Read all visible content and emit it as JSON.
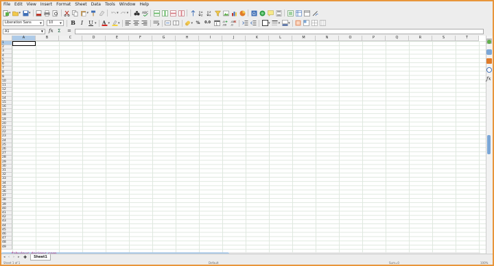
{
  "menu": [
    "File",
    "Edit",
    "View",
    "Insert",
    "Format",
    "Sheet",
    "Data",
    "Tools",
    "Window",
    "Help"
  ],
  "font": {
    "name": "Liberation Sans",
    "size": "10"
  },
  "formula": {
    "cell_ref": "A1",
    "fx": "fx",
    "sum": "Σ",
    "equals": "="
  },
  "columns": [
    "A",
    "B",
    "C",
    "D",
    "E",
    "F",
    "G",
    "H",
    "I",
    "J",
    "K",
    "L",
    "M",
    "N",
    "O",
    "P",
    "Q",
    "R",
    "S",
    "T"
  ],
  "rows": [
    "1",
    "2",
    "3",
    "4",
    "5",
    "6",
    "7",
    "8",
    "9",
    "10",
    "11",
    "12",
    "13",
    "14",
    "15",
    "16",
    "17",
    "18",
    "19",
    "20",
    "21",
    "22",
    "23",
    "24",
    "25",
    "26",
    "27",
    "28",
    "29",
    "30",
    "31",
    "32",
    "33",
    "34",
    "35",
    "36",
    "37",
    "38",
    "39",
    "40",
    "41",
    "42",
    "43",
    "44",
    "45",
    "46",
    "47",
    "48",
    "49"
  ],
  "sheet_tab": "Sheet1",
  "watermark": "fabulous-designs.com",
  "status": {
    "sheet": "Sheet 1 of 1",
    "style": "Default",
    "sum": "Sum=0",
    "zoom": "100%"
  },
  "toolbar_formatting": {
    "bold": "B",
    "italic": "I",
    "underline": "U",
    "percent": "%",
    "decimal": "0.0"
  },
  "colors": {
    "accent": "#e8953a",
    "selection": "#aecbe8",
    "grid": "#dfe8df",
    "font_color": "#d7261f",
    "highlight": "#f4d23a",
    "border_color": "#2a4d8f"
  }
}
